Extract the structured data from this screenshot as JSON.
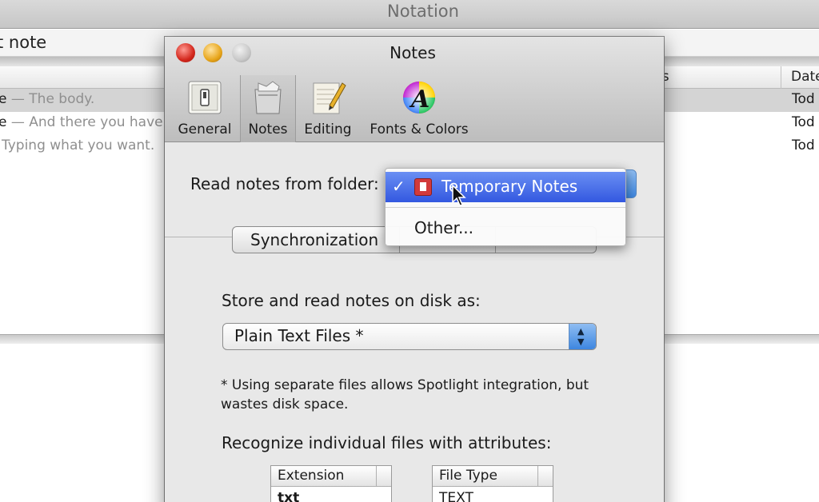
{
  "background_window": {
    "title": "Notation",
    "search_text": "t note",
    "columns": {
      "tags": "gs",
      "date": "Date"
    },
    "rows": [
      {
        "title": "e",
        "sep": " — ",
        "preview": "The body.",
        "date": "Tod",
        "selected": true
      },
      {
        "title": "e",
        "sep": " — ",
        "preview": "And there you have",
        "date": "Tod",
        "selected": false
      },
      {
        "title": "",
        "sep": "",
        "preview": "Typing what you want.",
        "date": "Tod",
        "selected": false
      }
    ]
  },
  "prefs": {
    "title": "Notes",
    "toolbar": [
      {
        "label": "General",
        "icon": "switch-icon"
      },
      {
        "label": "Notes",
        "icon": "notes-bag-icon",
        "selected": true
      },
      {
        "label": "Editing",
        "icon": "pencil-paper-icon"
      },
      {
        "label": "Fonts & Colors",
        "icon": "color-wheel-icon"
      }
    ],
    "folder_label": "Read notes from folder:",
    "tab_label": "Synchronization",
    "storage_label": "Store and read notes on disk as:",
    "storage_value": "Plain Text Files *",
    "note": "* Using separate files allows Spotlight integration, but wastes disk space.",
    "attributes_label": "Recognize individual files with attributes:",
    "extension_header": "Extension",
    "extension_value": "txt",
    "filetype_header": "File Type",
    "filetype_value": "TEXT"
  },
  "menu": {
    "selected_item": "Temporary Notes",
    "checkmark": "✓",
    "other_item": "Other..."
  },
  "colors": {
    "menu_highlight": "#3f64e8",
    "popup_accent": "#3d86e0",
    "close": "#d3271c",
    "minimize": "#e7a51a"
  }
}
